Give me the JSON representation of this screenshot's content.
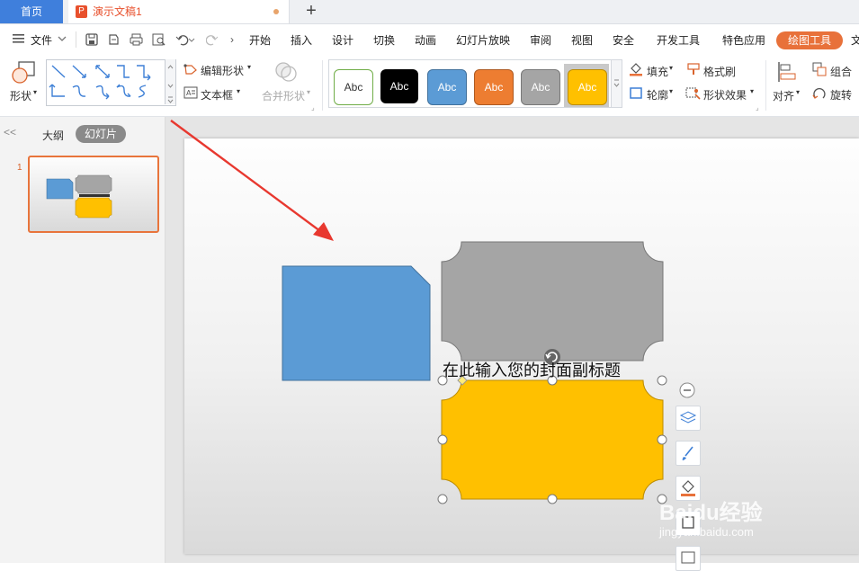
{
  "tabs": {
    "home": "首页",
    "doc_icon": "P",
    "doc_name": "演示文稿1",
    "add": "+"
  },
  "menu": {
    "file": "文件",
    "items": [
      "开始",
      "插入",
      "设计",
      "切换",
      "动画",
      "幻灯片放映",
      "审阅",
      "视图",
      "安全",
      "开发工具",
      "特色应用"
    ],
    "active": "绘图工具",
    "overflow": "文"
  },
  "ribbon": {
    "shape": "形状",
    "edit_shape": "编辑形状",
    "textbox": "文本框",
    "merge_shape": "合并形状",
    "style_samples": [
      "Abc",
      "Abc",
      "Abc",
      "Abc",
      "Abc",
      "Abc"
    ],
    "fill": "填充",
    "format_brush": "格式刷",
    "outline": "轮廓",
    "shape_effect": "形状效果",
    "align": "对齐",
    "group": "组合",
    "rotate": "旋转"
  },
  "colors": {
    "accent_orange": "#e8713a",
    "tab_blue": "#3f7fdc",
    "shape_blue": "#5b9bd5",
    "shape_gray": "#a5a5a5",
    "shape_yellow": "#ffc000",
    "arrow_red": "#e8382f"
  },
  "left_panel": {
    "collapse": "<<",
    "outline": "大纲",
    "slides": "幻灯片",
    "slide_number": "1"
  },
  "slide": {
    "subtitle": "在此输入您的封面副标题"
  },
  "watermark": {
    "text": "Baidu经验",
    "url": "jingyan.baidu.com"
  }
}
